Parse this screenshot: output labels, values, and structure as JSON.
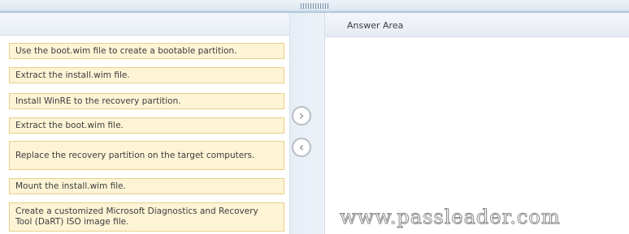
{
  "answer_area": {
    "title": "Answer Area"
  },
  "items": [
    {
      "label": "Use the boot.wim file to create a bootable partition."
    },
    {
      "label": "Extract the install.wim file."
    },
    {
      "label": "Install WinRE to the recovery partition."
    },
    {
      "label": "Extract the boot.wim file."
    },
    {
      "label": "Replace the recovery partition on the target computers."
    },
    {
      "label": "Mount the install.wim file."
    },
    {
      "label": "Create a customized Microsoft Diagnostics and Recovery Tool (DaRT) ISO image file."
    }
  ],
  "buttons": {
    "move_right": {
      "glyph": "›",
      "icon": "chevron-right-icon"
    },
    "move_left": {
      "glyph": "‹",
      "icon": "chevron-left-icon"
    }
  },
  "watermark": "www.passleader.com",
  "colors": {
    "item_fill": "#fdf4d6",
    "item_border": "#eacf86",
    "panel_header": "#e7edf4",
    "arrow_button_border": "#b9bdc4"
  }
}
